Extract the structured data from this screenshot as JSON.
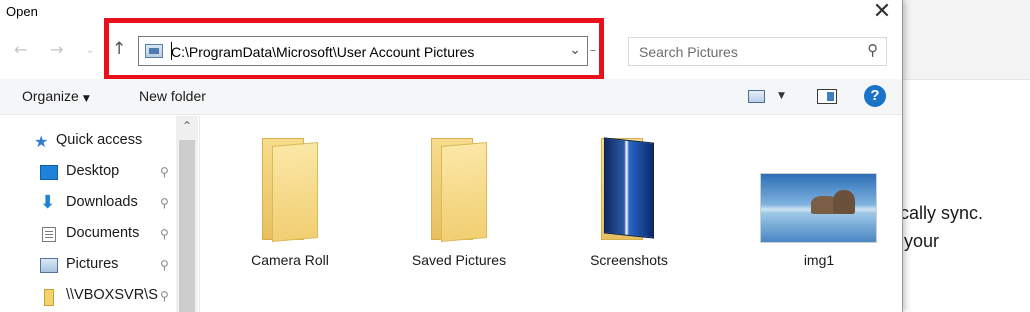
{
  "background_app": {
    "lines": [
      "tically sync.",
      "ll your"
    ]
  },
  "dialog": {
    "title": "Open",
    "close_label": "✕",
    "nav": {
      "back_glyph": "←",
      "forward_glyph": "→",
      "recent_glyph": "⌄",
      "up_glyph": "↑"
    },
    "address": {
      "path": "C:\\ProgramData\\Microsoft\\User Account Pictures",
      "dropdown_glyph": "⌄",
      "refresh_glyph": "–"
    },
    "search": {
      "placeholder": "Search Pictures",
      "icon_glyph": "⚲"
    },
    "toolbar": {
      "organize_label": "Organize",
      "organize_arrow": "▼",
      "new_folder_label": "New folder",
      "view_arrow": "▼",
      "help_label": "?"
    },
    "navpane": {
      "scroll_up_glyph": "⌃",
      "items": [
        {
          "label": "Quick access",
          "icon": "star-icon",
          "pinned": false
        },
        {
          "label": "Desktop",
          "icon": "desktop-icon",
          "pinned": true
        },
        {
          "label": "Downloads",
          "icon": "download-arrow-icon",
          "pinned": true
        },
        {
          "label": "Documents",
          "icon": "document-icon",
          "pinned": true
        },
        {
          "label": "Pictures",
          "icon": "pictures-icon",
          "pinned": true
        },
        {
          "label": "\\\\VBOXSVR\\S",
          "icon": "network-share-icon",
          "pinned": true
        }
      ],
      "pin_glyph": "📌"
    },
    "content": {
      "items": [
        {
          "label": "Camera Roll",
          "type": "folder"
        },
        {
          "label": "Saved Pictures",
          "type": "folder"
        },
        {
          "label": "Screenshots",
          "type": "folder"
        },
        {
          "label": "img1",
          "type": "image"
        }
      ]
    },
    "highlight_color": "#e8101a",
    "accent_color": "#1a72c9"
  }
}
